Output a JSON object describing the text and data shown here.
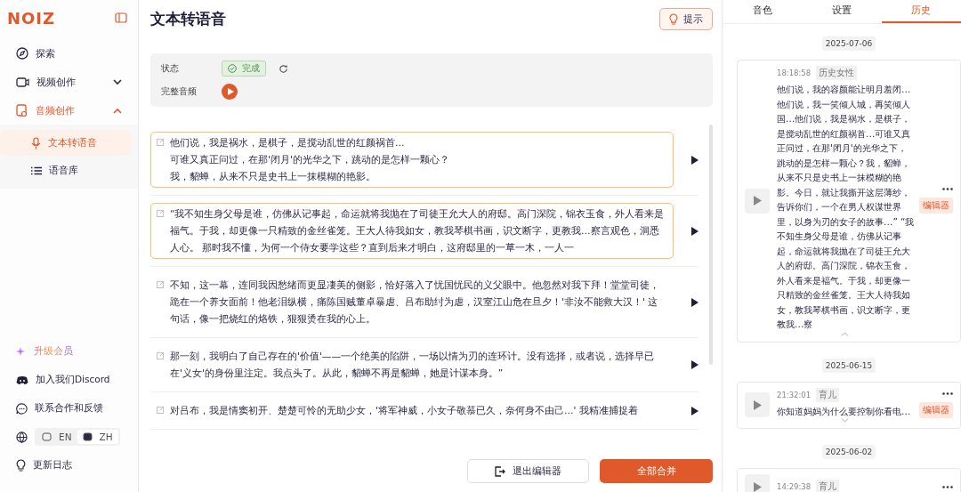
{
  "logo": "NOIZ",
  "sidebar": {
    "items": [
      {
        "label": "探索",
        "kind": "link"
      },
      {
        "label": "视频创作",
        "kind": "group",
        "expanded": false,
        "selected": false
      },
      {
        "label": "音频创作",
        "kind": "group",
        "expanded": true,
        "selected": true,
        "children": [
          {
            "label": "文本转语音",
            "selected": true
          },
          {
            "label": "语音库",
            "selected": false
          }
        ]
      }
    ],
    "bottom": [
      {
        "label": "升级会员",
        "kind": "upgrade"
      },
      {
        "label": "加入我们Discord",
        "kind": "discord"
      },
      {
        "label": "联系合作和反馈",
        "kind": "chat"
      },
      {
        "kind": "language",
        "options": [
          {
            "label": "EN",
            "selected": false
          },
          {
            "label": "ZH",
            "selected": true
          }
        ]
      },
      {
        "label": "更新日志",
        "kind": "bulb"
      }
    ]
  },
  "main": {
    "title": "文本转语音",
    "hint_button": "提示",
    "status": {
      "label": "状态",
      "value": "完成",
      "audio_label": "完整音频"
    },
    "segments": [
      {
        "selected": true,
        "lines": [
          "他们说，我是祸水，是棋子，是搅动乱世的红颜祸首…",
          "可谁又真正问过，在那'闭月'的光华之下，跳动的是怎样一颗心？",
          "我，貂蝉，从来不只是史书上一抹模糊的艳影。"
        ]
      },
      {
        "selected": true,
        "text": "“我不知生身父母是谁，仿佛从记事起，命运就将我抛在了司徒王允大人的府邸。高门深院，锦衣玉食，外人看来是福气。于我，却更像一只精致的金丝雀笼。王大人待我如女，教我琴棋书画，识文断字，更教我…察言观色，洞悉人心。 那时我不懂，为何一个侍女要学这些？直到后来才明白，这府邸里的一草一木，一人一"
      },
      {
        "selected": false,
        "text": "不知，这一幕，连同我因愁绪而更显凄美的侧影，恰好落入了忧国忧民的义父眼中。他忽然对我下拜！堂堂司徒，跪在一个养女面前！他老泪纵横，痛陈国贼董卓暴虐、吕布助纣为虐，汉室江山危在旦夕！'非汝不能救大汉！' 这句话，像一把烧红的烙铁，狠狠烫在我的心上。"
      },
      {
        "selected": false,
        "text": "那一刻，我明白了自己存在的'价值'——一个绝美的陷阱，一场以情为刃的连环计。没有选择，或者说，选择早已在'义女'的身份里注定。我点头了。从此，貂蝉不再是貂蝉，她是计谋本身。”"
      },
      {
        "selected": false,
        "text": "对吕布，我是情窦初开、楚楚可怜的无助少女，'将军神威，小女子敬慕已久，奈何身不由己…' 我精准捕捉着"
      }
    ],
    "exit_button": "退出编辑器",
    "merge_button": "全部合并"
  },
  "panel": {
    "tabs": [
      {
        "label": "音色",
        "selected": false
      },
      {
        "label": "设置",
        "selected": false
      },
      {
        "label": "历史",
        "selected": true
      }
    ],
    "history": [
      {
        "date": "2025-07-06",
        "entries": [
          {
            "time": "18:18:58",
            "tag": "历史女性",
            "badge": "编辑器",
            "expanded": true,
            "text": "他们说，我的容颜能让明月羞闭…他们说，我一笑倾人城，再笑倾人国…他们说，我是祸水，是棋子，是搅动乱世的红颜祸首…可谁又真正问过，在那'闭月'的光华之下，跳动的是怎样一颗心？我，貂蝉，从来不只是史书上一抹模糊的艳影。今日，就让我撕开这层薄纱，告诉你们，一个在男人权谋世界里，以身为刃的女子的故事…” “我不知生身父母是谁，仿佛从记事起，命运就将我抛在了司徒王允大人的府邸。高门深院，锦衣玉食，外人看来是福气。于我，却更像一只精致的金丝雀笼。王大人待我如女，教我琴棋书画，识文断字，更教我…察"
          }
        ]
      },
      {
        "date": "2025-06-15",
        "entries": [
          {
            "time": "21:32:01",
            "tag": "育儿",
            "badge": "编辑器",
            "expanded": false,
            "text": "你知道妈妈为什么要控制你看电…"
          }
        ]
      },
      {
        "date": "2025-06-02",
        "entries": [
          {
            "time": "14:29:38",
            "tag": "育儿"
          }
        ]
      }
    ]
  }
}
